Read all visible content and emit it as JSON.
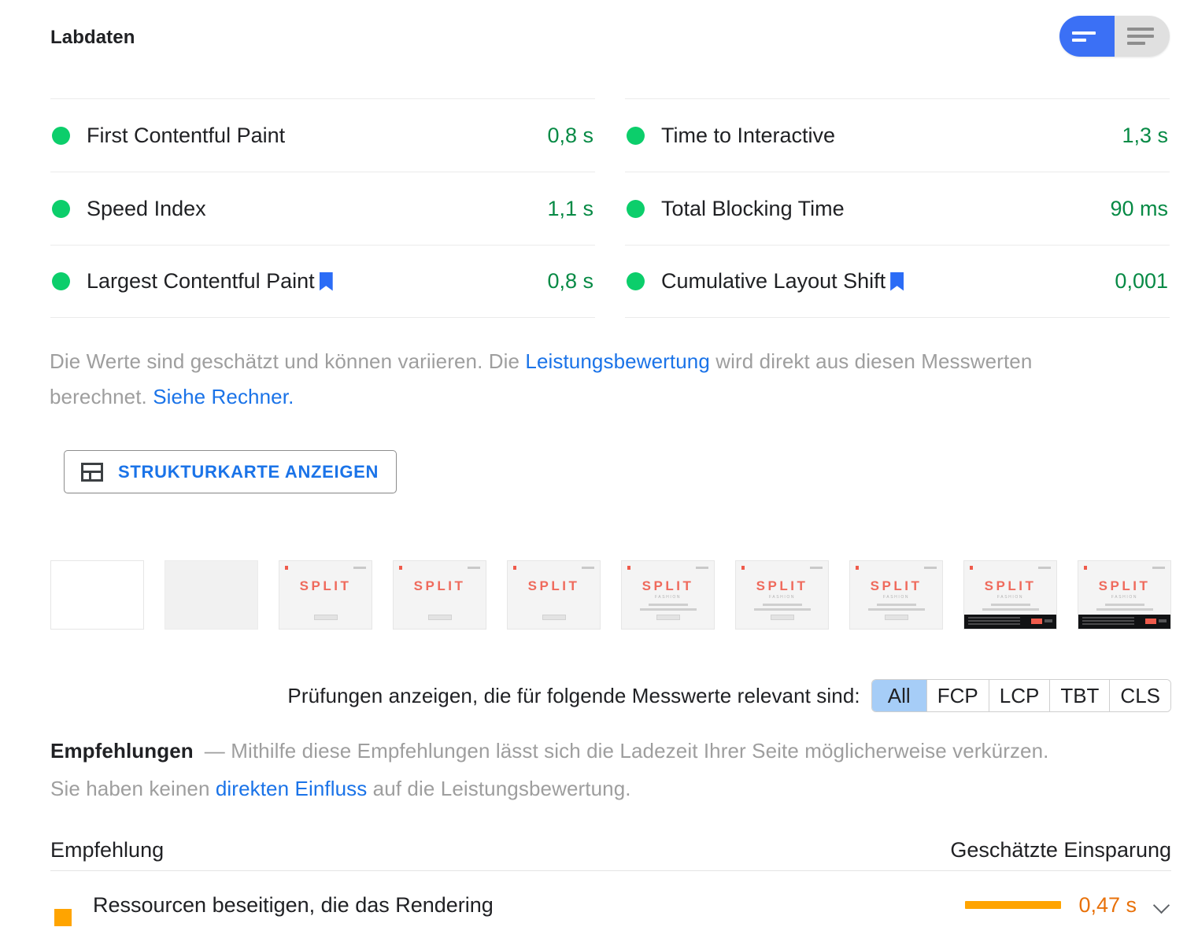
{
  "header": {
    "title": "Labdaten",
    "view_toggle": {
      "options": [
        "compact-view",
        "list-view"
      ],
      "selected": "compact-view",
      "active_color": "#3b70f5",
      "inactive_color": "#e0e0e0"
    }
  },
  "metrics": {
    "left_column": [
      {
        "status": "pass",
        "name": "First Contentful Paint",
        "value": "0,8 s",
        "bookmarked": false
      },
      {
        "status": "pass",
        "name": "Speed Index",
        "value": "1,1 s",
        "bookmarked": false
      },
      {
        "status": "pass",
        "name": "Largest Contentful Paint",
        "value": "0,8 s",
        "bookmarked": true
      }
    ],
    "right_column": [
      {
        "status": "pass",
        "name": "Time to Interactive",
        "value": "1,3 s",
        "bookmarked": false
      },
      {
        "status": "pass",
        "name": "Total Blocking Time",
        "value": "90 ms",
        "bookmarked": false
      },
      {
        "status": "pass",
        "name": "Cumulative Layout Shift",
        "value": "0,001",
        "bookmarked": true
      }
    ],
    "pass_color": "#0cce6b",
    "value_color": "#078a45",
    "bookmark_color": "#2b6cf6"
  },
  "description": {
    "part1": "Die Werte sind geschätzt und können variieren. Die ",
    "link1": "Leistungsbewertung",
    "part2": " wird direkt aus diesen Messwerten berechnet. ",
    "link2": "Siehe Rechner."
  },
  "treemap_button": {
    "label": "STRUKTURKARTE ANZEIGEN",
    "icon": "treemap-icon",
    "text_color": "#1a73e8"
  },
  "filmstrip": {
    "frames": [
      {
        "state": "blank"
      },
      {
        "state": "plain"
      },
      {
        "state": "logo"
      },
      {
        "state": "logo"
      },
      {
        "state": "logo"
      },
      {
        "state": "logo-sub"
      },
      {
        "state": "logo-sub"
      },
      {
        "state": "logo-sub"
      },
      {
        "state": "logo-sub-footer"
      },
      {
        "state": "logo-sub-footer"
      }
    ],
    "logo_text": "SPLIT",
    "sub_text": "FASHION"
  },
  "filter": {
    "label": "Prüfungen anzeigen, die für folgende Messwerte relevant sind:",
    "chips": [
      {
        "label": "All",
        "selected": true
      },
      {
        "label": "FCP",
        "selected": false
      },
      {
        "label": "LCP",
        "selected": false
      },
      {
        "label": "TBT",
        "selected": false
      },
      {
        "label": "CLS",
        "selected": false
      }
    ],
    "selected_color": "#a6cdf7"
  },
  "recommendations": {
    "title": "Empfehlungen",
    "dash": "—",
    "line1_text": "Mithilfe diese Empfehlungen lässt sich die Ladezeit Ihrer Seite möglicherweise verkürzen.",
    "line2_part1": "Sie haben keinen ",
    "line2_link": "direkten Einfluss",
    "line2_part2": " auf die Leistungsbewertung.",
    "table": {
      "col_recommendation": "Empfehlung",
      "col_savings": "Geschätzte Einsparung",
      "rows": [
        {
          "severity": "warning",
          "severity_color": "#ffa400",
          "text": "Ressourcen beseitigen, die das Rendering",
          "savings": "0,47 s",
          "savings_color": "#e8710a",
          "expanded": false
        }
      ]
    }
  }
}
